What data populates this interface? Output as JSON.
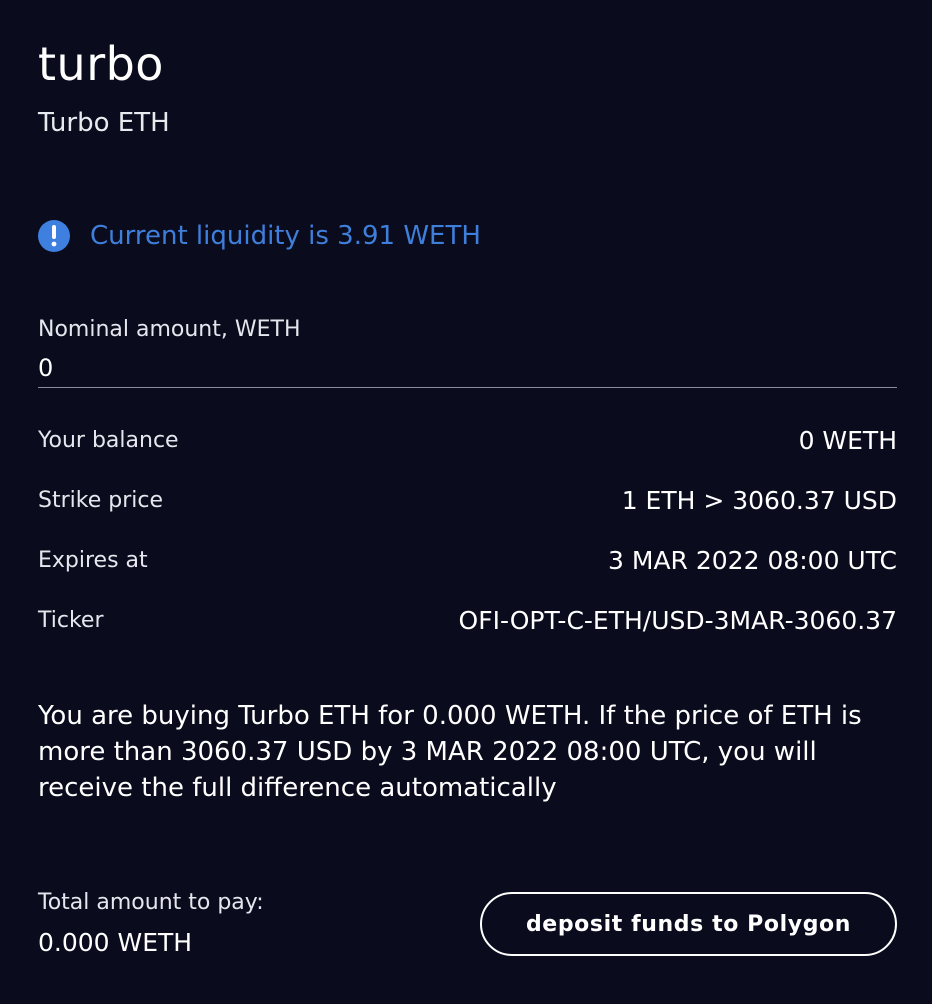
{
  "header": {
    "title": "turbo",
    "subtitle": "Turbo ETH"
  },
  "alert": {
    "icon": "exclamation-icon",
    "text": "Current liquidity is 3.91 WETH",
    "color": "#3f7fdc"
  },
  "amount_field": {
    "label": "Nominal amount, WETH",
    "value": "0"
  },
  "details": [
    {
      "label": "Your balance",
      "value": "0 WETH"
    },
    {
      "label": "Strike price",
      "value": "1 ETH > 3060.37 USD"
    },
    {
      "label": "Expires at",
      "value": "3 MAR 2022 08:00 UTC"
    },
    {
      "label": "Ticker",
      "value": "OFI-OPT-C-ETH/USD-3MAR-3060.37"
    }
  ],
  "description": "You are buying Turbo ETH for 0.000 WETH. If the price of ETH is more than 3060.37 USD by 3 MAR 2022 08:00 UTC, you will receive the full difference automatically",
  "total": {
    "label": "Total amount to pay:",
    "value": "0.000 WETH"
  },
  "actions": {
    "deposit_label": "deposit funds to Polygon"
  },
  "colors": {
    "background": "#0a0b1c",
    "accent": "#3e7fe0"
  }
}
